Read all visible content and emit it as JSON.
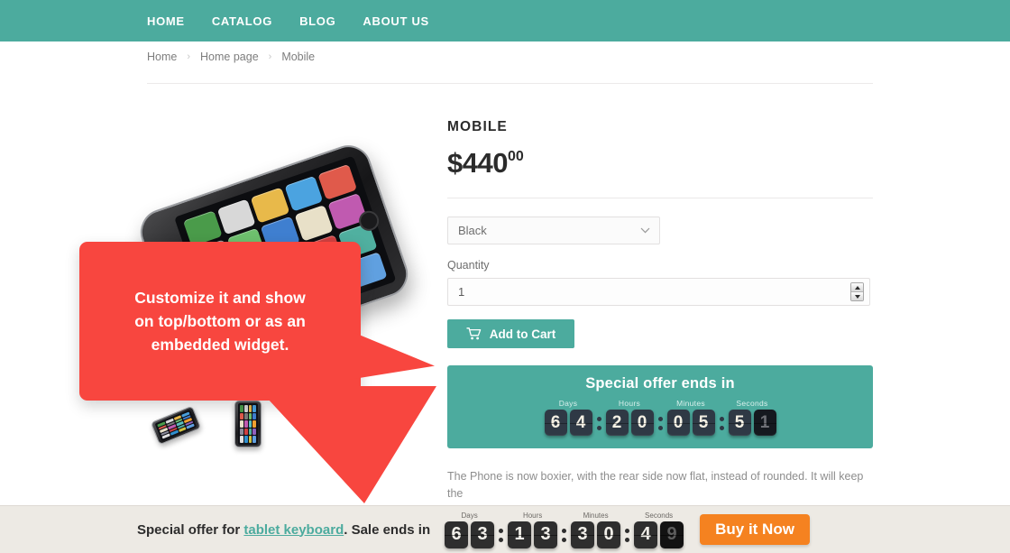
{
  "nav": {
    "items": [
      {
        "label": "HOME"
      },
      {
        "label": "CATALOG"
      },
      {
        "label": "BLOG"
      },
      {
        "label": "ABOUT US"
      }
    ]
  },
  "breadcrumb": {
    "separator": "›",
    "items": [
      {
        "label": "Home"
      },
      {
        "label": "Home page"
      },
      {
        "label": "Mobile"
      }
    ]
  },
  "product": {
    "title": "MOBILE",
    "price_main": "$440",
    "price_cents": "00",
    "variant_label": "Black",
    "variant_options": [
      "Black"
    ],
    "quantity_label": "Quantity",
    "quantity_value": "1",
    "add_to_cart_label": "Add to Cart",
    "cart_icon": "shopping-cart-icon",
    "description": "The Phone  is now boxier, with the rear side now flat, instead of rounded. It will keep the"
  },
  "widget": {
    "title": "Special offer ends in",
    "units": [
      {
        "label": "Days",
        "digits": [
          "6",
          "4"
        ],
        "flip": [
          false,
          false
        ]
      },
      {
        "label": "Hours",
        "digits": [
          "2",
          "0"
        ],
        "flip": [
          false,
          false
        ]
      },
      {
        "label": "Minutes",
        "digits": [
          "0",
          "5"
        ],
        "flip": [
          false,
          false
        ]
      },
      {
        "label": "Seconds",
        "digits": [
          "5",
          "1"
        ],
        "flip": [
          false,
          true
        ]
      }
    ]
  },
  "callout": {
    "text": "Customize it and show\non top/bottom or as an\nembedded widget.",
    "color": "#f8463f"
  },
  "bottom_bar": {
    "text_before": "Special offer for ",
    "link_text": "tablet keyboard",
    "text_after": ". Sale ends in",
    "buy_label": "Buy it Now",
    "units": [
      {
        "label": "Days",
        "digits": [
          "6",
          "3"
        ],
        "flip": [
          false,
          false
        ]
      },
      {
        "label": "Hours",
        "digits": [
          "1",
          "3"
        ],
        "flip": [
          false,
          false
        ]
      },
      {
        "label": "Minutes",
        "digits": [
          "3",
          "0"
        ],
        "flip": [
          false,
          false
        ]
      },
      {
        "label": "Seconds",
        "digits": [
          "4",
          "9"
        ],
        "flip": [
          false,
          true
        ]
      }
    ]
  },
  "theme": {
    "teal": "#4cab9e",
    "orange": "#f58220",
    "red": "#f8463f",
    "bar_bg": "#edeae4",
    "digit_dark": "#2f3945"
  },
  "gallery": {
    "main_image": "phone-product-photo",
    "thumbnails": [
      "phone-thumb-angled",
      "phone-thumb-front",
      "phone-thumb-side"
    ]
  }
}
